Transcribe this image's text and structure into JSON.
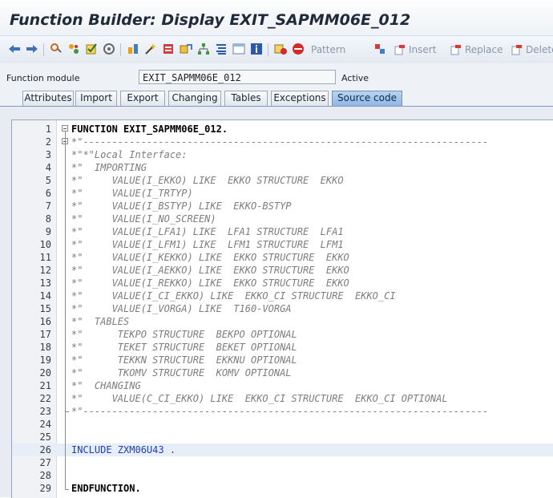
{
  "window": {
    "title": "Function Builder: Display EXIT_SAPMM06E_012"
  },
  "toolbar": {
    "pattern_label": "Pattern",
    "insert_label": "Insert",
    "replace_label": "Replace",
    "delete_label": "Delete"
  },
  "fields": {
    "function_module_label": "Function module",
    "function_module_value": "EXIT_SAPMM06E_012",
    "status": "Active"
  },
  "tabs": [
    {
      "label": "Attributes"
    },
    {
      "label": "Import"
    },
    {
      "label": "Export"
    },
    {
      "label": "Changing"
    },
    {
      "label": "Tables"
    },
    {
      "label": "Exceptions"
    },
    {
      "label": "Source code"
    }
  ],
  "active_tab": "Source code",
  "code_lines": [
    {
      "n": "1",
      "t": "FUNCTION EXIT_SAPMM06E_012."
    },
    {
      "n": "2",
      "t": "*\"----------------------------------------------------------------------"
    },
    {
      "n": "3",
      "t": "*\"*\"Local Interface:"
    },
    {
      "n": "4",
      "t": "*\"  IMPORTING"
    },
    {
      "n": "5",
      "t": "*\"     VALUE(I_EKKO) LIKE  EKKO STRUCTURE  EKKO"
    },
    {
      "n": "6",
      "t": "*\"     VALUE(I_TRTYP)"
    },
    {
      "n": "7",
      "t": "*\"     VALUE(I_BSTYP) LIKE  EKKO-BSTYP"
    },
    {
      "n": "8",
      "t": "*\"     VALUE(I_NO_SCREEN)"
    },
    {
      "n": "9",
      "t": "*\"     VALUE(I_LFA1) LIKE  LFA1 STRUCTURE  LFA1"
    },
    {
      "n": "10",
      "t": "*\"     VALUE(I_LFM1) LIKE  LFM1 STRUCTURE  LFM1"
    },
    {
      "n": "11",
      "t": "*\"     VALUE(I_KEKKO) LIKE  EKKO STRUCTURE  EKKO"
    },
    {
      "n": "12",
      "t": "*\"     VALUE(I_AEKKO) LIKE  EKKO STRUCTURE  EKKO"
    },
    {
      "n": "13",
      "t": "*\"     VALUE(I_REKKO) LIKE  EKKO STRUCTURE  EKKO"
    },
    {
      "n": "14",
      "t": "*\"     VALUE(I_CI_EKKO) LIKE  EKKO_CI STRUCTURE  EKKO_CI"
    },
    {
      "n": "15",
      "t": "*\"     VALUE(I_VORGA) LIKE  T160-VORGA"
    },
    {
      "n": "16",
      "t": "*\"  TABLES"
    },
    {
      "n": "17",
      "t": "*\"      TEKPO STRUCTURE  BEKPO OPTIONAL"
    },
    {
      "n": "18",
      "t": "*\"      TEKET STRUCTURE  BEKET OPTIONAL"
    },
    {
      "n": "19",
      "t": "*\"      TEKKN STRUCTURE  EKKNU OPTIONAL"
    },
    {
      "n": "20",
      "t": "*\"      TKOMV STRUCTURE  KOMV OPTIONAL"
    },
    {
      "n": "21",
      "t": "*\"  CHANGING"
    },
    {
      "n": "22",
      "t": "*\"     VALUE(C_CI_EKKO) LIKE  EKKO_CI STRUCTURE  EKKO_CI OPTIONAL"
    },
    {
      "n": "23",
      "t": "*\"----------------------------------------------------------------------"
    },
    {
      "n": "24",
      "t": ""
    },
    {
      "n": "25",
      "t": ""
    },
    {
      "n": "26",
      "t": "INCLUDE ZXM06U43 ."
    },
    {
      "n": "27",
      "t": ""
    },
    {
      "n": "28",
      "t": ""
    },
    {
      "n": "29",
      "t": "ENDFUNCTION."
    }
  ]
}
